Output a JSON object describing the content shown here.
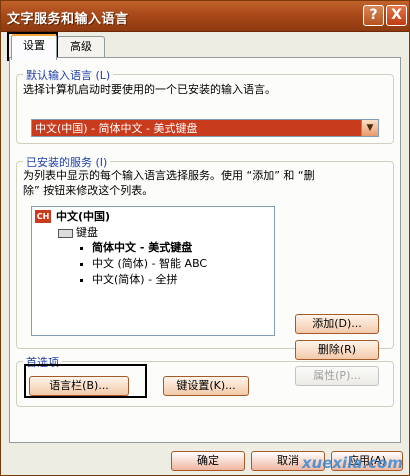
{
  "window": {
    "title": "文字服务和输入语言",
    "help_label": "?",
    "close_label": "X"
  },
  "tabs": [
    {
      "label": "设置",
      "active": true
    },
    {
      "label": "高级",
      "active": false
    }
  ],
  "default_language": {
    "title": "默认输入语言 (L)",
    "description": "选择计算机启动时要使用的一个已安装的输入语言。",
    "selected": "中文(中国) - 简体中文 - 美式键盘"
  },
  "installed_services": {
    "title": "已安装的服务 (I)",
    "description_line1": "为列表中显示的每个输入语言选择服务。使用 “添加” 和 “删",
    "description_line2": "除” 按钮来修改这个列表。",
    "language_icon": "CH",
    "language": "中文(中国)",
    "category": "键盘",
    "items": [
      "简体中文 - 美式键盘",
      "中文 (简体) - 智能 ABC",
      "中文(简体) - 全拼"
    ],
    "add_label": "添加(D)...",
    "remove_label": "删除(R)",
    "properties_label": "属性(P)..."
  },
  "preferences": {
    "title": "首选项",
    "language_bar_label": "语言栏(B)...",
    "key_settings_label": "键设置(K)..."
  },
  "footer": {
    "ok_label": "确定",
    "cancel_label": "取消",
    "apply_label": "应用(A)"
  },
  "watermark": "xuexila.com",
  "colors": {
    "titlebar": "#a9491a",
    "accent_orange": "#c83b1c",
    "group_title": "#1f3fa7"
  }
}
